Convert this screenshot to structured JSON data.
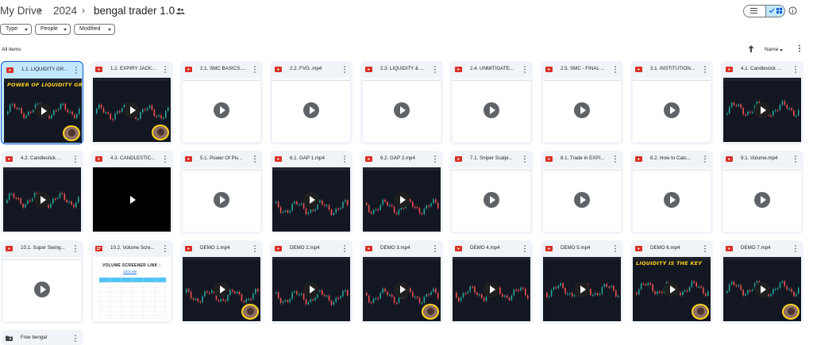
{
  "breadcrumb": [
    "My Drive",
    "2024",
    "bengal trader 1.0"
  ],
  "filters": [
    "Type",
    "People",
    "Modified"
  ],
  "section_label": "All items",
  "sort_label": "Name",
  "colors": {
    "accent": "#0b57d0",
    "selected_bg": "#c2e7ff",
    "card_bg": "#f0f4f9",
    "video_icon": "#d93025"
  },
  "files": [
    {
      "name": "1.1. LIQUIDITY GR...",
      "kind": "video",
      "thumb": "dark",
      "overlay": "POWER OF LIQUIDITY GRAB",
      "presenter": true,
      "selected": true
    },
    {
      "name": "1.2. EXPIRY JACK...",
      "kind": "video",
      "thumb": "dark",
      "presenter": true
    },
    {
      "name": "2.1. SMC BASICS....",
      "kind": "video",
      "thumb": "light"
    },
    {
      "name": "2.2. FVG..mp4",
      "kind": "video",
      "thumb": "light"
    },
    {
      "name": "2.3. LIQUIDITY & ...",
      "kind": "video",
      "thumb": "light"
    },
    {
      "name": "2.4. UNMITIGATE...",
      "kind": "video",
      "thumb": "light"
    },
    {
      "name": "2.5. SMC - FINAL ...",
      "kind": "video",
      "thumb": "light"
    },
    {
      "name": "3.1. INSTITUTION...",
      "kind": "video",
      "thumb": "light"
    },
    {
      "name": "4.1. Candlestick ...",
      "kind": "video",
      "thumb": "dark"
    },
    {
      "name": "4.2. Candlestick ...",
      "kind": "video",
      "thumb": "dark"
    },
    {
      "name": "4.3. CANDLESTIC...",
      "kind": "video",
      "thumb": "black"
    },
    {
      "name": "5.1. Power Of Piv...",
      "kind": "video",
      "thumb": "light"
    },
    {
      "name": "6.1. GAP 1.mp4",
      "kind": "video",
      "thumb": "dark"
    },
    {
      "name": "6.2. GAP 2.mp4",
      "kind": "video",
      "thumb": "dark"
    },
    {
      "name": "7.1. Sniper Scalpi...",
      "kind": "video",
      "thumb": "light"
    },
    {
      "name": "8.1. Trade in EXPI...",
      "kind": "video",
      "thumb": "light"
    },
    {
      "name": "8.2. How to Catc...",
      "kind": "video",
      "thumb": "light"
    },
    {
      "name": "9.1. Volume.mp4",
      "kind": "video",
      "thumb": "light"
    },
    {
      "name": "10.1. Super Swing...",
      "kind": "video",
      "thumb": "light"
    },
    {
      "name": "10.2. Volume Scre...",
      "kind": "doc",
      "thumb": "doc",
      "doc_title": "VOLUME SCREENER LINK :",
      "doc_link": "Click Me"
    },
    {
      "name": "DEMO 1.mp4",
      "kind": "video",
      "thumb": "dark",
      "presenter": true
    },
    {
      "name": "DEMO 2.mp4",
      "kind": "video",
      "thumb": "dark"
    },
    {
      "name": "DEMO 3.mp4",
      "kind": "video",
      "thumb": "dark",
      "presenter": true
    },
    {
      "name": "DEMO 4.mp4",
      "kind": "video",
      "thumb": "dark"
    },
    {
      "name": "DEMO 5.mp4",
      "kind": "video",
      "thumb": "dark"
    },
    {
      "name": "DEMO 6.mp4",
      "kind": "video",
      "thumb": "dark",
      "overlay": "LIQUIDITY IS THE KEY",
      "presenter": true
    },
    {
      "name": "DEMO 7.mp4",
      "kind": "video",
      "thumb": "dark",
      "presenter": true
    },
    {
      "name": "Free bengal",
      "kind": "folder"
    }
  ]
}
